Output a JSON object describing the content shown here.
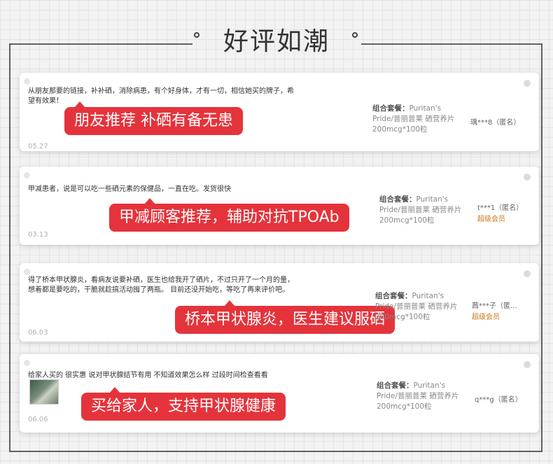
{
  "header": {
    "title": "好评如潮"
  },
  "colors": {
    "accent": "#e5333b",
    "member": "#c8781a"
  },
  "package_label": "组合套餐：",
  "reviews": [
    {
      "text_line1": "从朋友那要的链接，补补硒，消除病患，有个好身体，才有一切，相信她买的牌子，希",
      "text_line2": "望有效果！",
      "badge": "朋友推荐  补硒有备无患",
      "date": "05.27",
      "package": "Puritan's Pride/普丽普莱 硒营养片 200mcg*100粒",
      "user": "瑀***8（匿名）",
      "level": ""
    },
    {
      "text_line1": "甲减患者，说是可以吃一些硒元素的保健品，一直在吃。发货很快",
      "text_line2": "",
      "badge": "甲减顾客推荐，辅助对抗TPOAb",
      "date": "03.13",
      "package": "Puritan's Pride/普丽普莱 硒营养片 200mcg*100粒",
      "user": "t***1（匿名）",
      "level": "超级会员"
    },
    {
      "text_line1": "得了桥本甲状腺炎，看病友说要补硒，医生也给我开了硒片，不过只开了一个月的量，",
      "text_line2": "想着都是要吃的，干脆就趁搞活动囤了两瓶。 目前还没开始吃，等吃了再来评价吧。",
      "badge": "桥本甲状腺炎，医生建议服硒",
      "date": "06.03",
      "package": "Puritan's Pride/普丽普莱 硒营养片 200mcg*100粒",
      "user": "茜***子（匿...",
      "level": "超级会员"
    },
    {
      "text_line1": "给家人买的 很实惠 说对甲状腺结节有用 不知道效果怎么样 过段时间检查看看",
      "text_line2": "",
      "badge": "买给家人，支持甲状腺健康",
      "date": "06.06",
      "package": "Puritan's Pride/普丽普莱 硒营养片 200mcg*100粒",
      "user": "q***g（匿名）",
      "level": ""
    }
  ]
}
